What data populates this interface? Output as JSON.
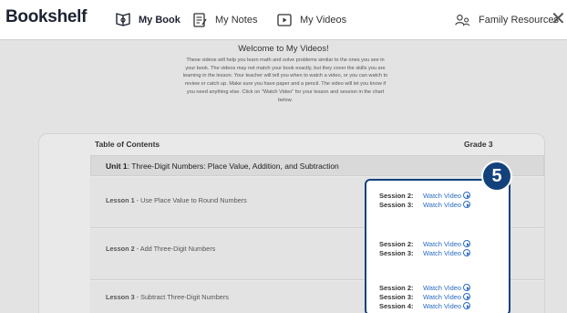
{
  "header": {
    "brand": "Bookshelf",
    "nav": [
      {
        "label": "My Book",
        "icon": "book-icon"
      },
      {
        "label": "My Notes",
        "icon": "notes-icon"
      },
      {
        "label": "My Videos",
        "icon": "video-icon"
      }
    ],
    "family": {
      "label": "Family Resources",
      "icon": "family-icon"
    },
    "close": "✕"
  },
  "intro": {
    "title": "Welcome to My Videos!",
    "text": "These videos will help you learn math and solve problems similar to the ones you see in your book. The videos may not match your book exactly, but they cover the skills you are learning in the lesson. Your teacher will tell you when to watch a video, or you can watch to review or catch up. Make sure you have paper and a pencil. The video will let you know if you need anything else. Click on \"Watch Video\" for your lesson and session in the chart below."
  },
  "toc": {
    "title": "Table of Contents",
    "grade": "Grade 3",
    "unit": {
      "label": "Unit 1",
      "title": ": Three-Digit Numbers: Place Value, Addition, and Subtraction"
    },
    "lessons": [
      {
        "label": "Lesson 1",
        "title": " - Use Place Value to Round Numbers",
        "sessions": [
          {
            "label": "Session 2:",
            "link": "Watch Video"
          },
          {
            "label": "Session 3:",
            "link": "Watch Video"
          }
        ]
      },
      {
        "label": "Lesson 2",
        "title": " - Add Three-Digit Numbers",
        "sessions": [
          {
            "label": "Session 2:",
            "link": "Watch Video"
          },
          {
            "label": "Session 3:",
            "link": "Watch Video"
          }
        ]
      },
      {
        "label": "Lesson 3",
        "title": " - Subtract Three-Digit Numbers",
        "sessions": [
          {
            "label": "Session 2:",
            "link": "Watch Video"
          },
          {
            "label": "Session 3:",
            "link": "Watch Video"
          },
          {
            "label": "Session 4:",
            "link": "Watch Video"
          }
        ]
      }
    ]
  },
  "callout": {
    "number": "5"
  },
  "colors": {
    "accent": "#13417b",
    "link": "#2b6cc4"
  }
}
